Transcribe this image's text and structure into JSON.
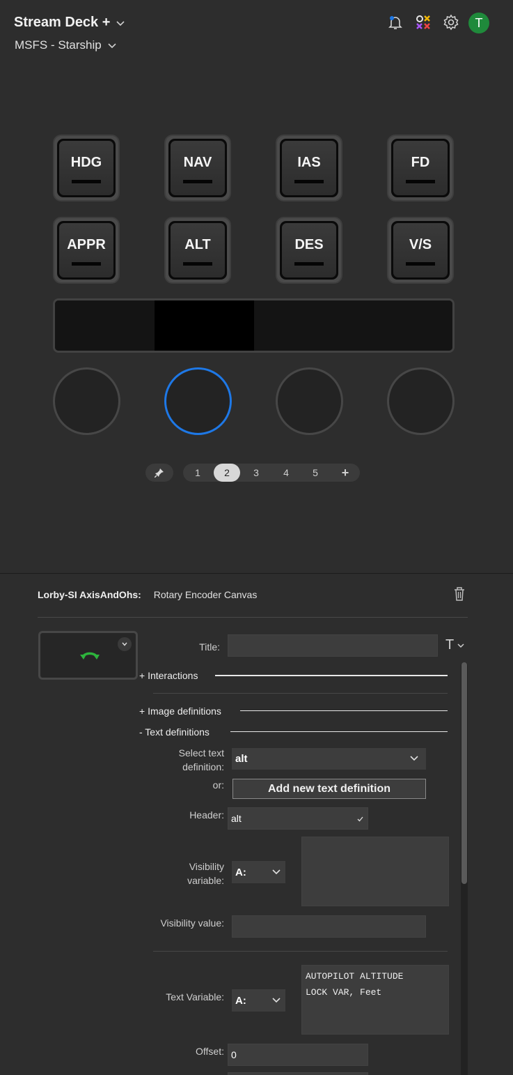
{
  "header": {
    "device_title": "Stream Deck +",
    "profile": "MSFS - Starship",
    "avatar_initial": "T"
  },
  "keys": [
    "HDG",
    "NAV",
    "IAS",
    "FD",
    "APPR",
    "ALT",
    "DES",
    "V/S"
  ],
  "pages": {
    "items": [
      "1",
      "2",
      "3",
      "4",
      "5"
    ],
    "selected": "2",
    "add_label": "+"
  },
  "inspector": {
    "plugin_name": "Lorby-SI AxisAndOhs:",
    "action_name": "Rotary Encoder Canvas",
    "title_label": "Title:",
    "title_value": "",
    "title_font_icon": "T",
    "sections": {
      "interactions": "+ Interactions",
      "image_definitions": "+ Image definitions",
      "text_definitions": "-  Text definitions"
    },
    "select_text_label_1": "Select text",
    "select_text_label_2": "definition:",
    "select_text_value": "alt",
    "or_label": "or:",
    "add_button": "Add new text definition",
    "header_label": "Header:",
    "header_value": "alt",
    "visibility_var_label_1": "Visibility",
    "visibility_var_label_2": "variable:",
    "visibility_var_type": "A:",
    "visibility_var_text": "",
    "visibility_value_label": "Visibility value:",
    "visibility_value": "",
    "text_var_label": "Text Variable:",
    "text_var_type": "A:",
    "text_var_line1": "AUTOPILOT ALTITUDE",
    "text_var_line2": "LOCK VAR, Feet",
    "offset_label": "Offset:",
    "offset_value": "0"
  },
  "colors": {
    "background": "#2d2d2d",
    "selected_dial": "#1e78e6",
    "avatar": "#1f8a3b",
    "preview_icon": "#2db43c"
  },
  "icons": {
    "notifications": "bell-icon",
    "marketplace": "marketplace-icon",
    "settings": "gear-icon",
    "delete": "trash-icon",
    "pin": "pin-icon",
    "preview": "rotate-arrow-icon"
  }
}
